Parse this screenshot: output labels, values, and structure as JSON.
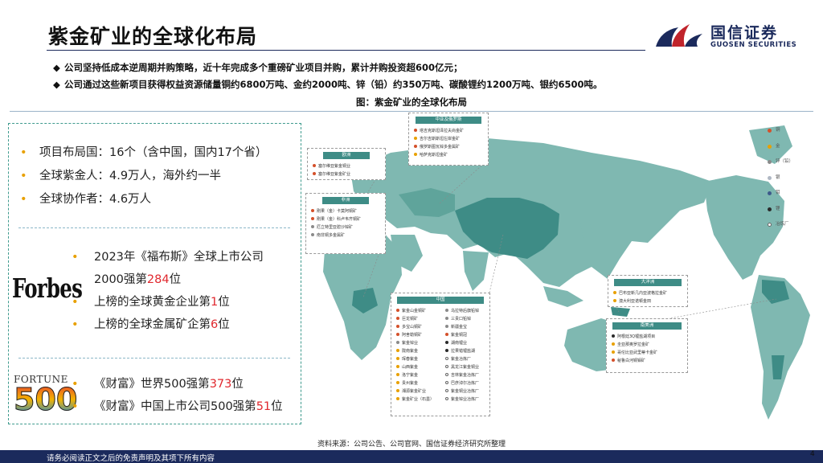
{
  "header": {
    "title": "紫金矿业的全球化布局",
    "logo_cn": "国信证券",
    "logo_en": "GUOSEN SECURITIES",
    "brand_colors": {
      "navy": "#1b2a5c",
      "red": "#c0242b",
      "teal": "#3f9b8e"
    }
  },
  "bullets": [
    "公司坚持低成本逆周期并购策略，近十年完成多个重磅矿业项目并购，累计并购投资超600亿元；",
    "公司通过这些新项目获得权益资源储量铜约6800万吨、金约2000吨、锌（铅）约350万吨、碳酸锂约1200万吨、银约6500吨。"
  ],
  "bullet_marker": "◆",
  "figure_title": "图：紫金矿业的全球化布局",
  "info_panel": {
    "stats": [
      "项目布局国：16个（含中国，国内17个省）",
      "全球紫金人：4.9万人，海外约一半",
      "全球协作者：4.6万人"
    ],
    "forbes": {
      "logo_text": "Forbes",
      "items": [
        {
          "pre": "2023年《福布斯》全球上市公司",
          "num": "",
          "post": ""
        },
        {
          "pre": "2000强第",
          "num": "284",
          "post": "位"
        },
        {
          "pre": "上榜的全球黄金企业第",
          "num": "1",
          "post": "位"
        },
        {
          "pre": "上榜的全球金属矿企第",
          "num": "6",
          "post": "位"
        }
      ]
    },
    "fortune": {
      "logo_word": "FORTUNE",
      "logo_number": "500",
      "items": [
        {
          "pre": "《财富》世界500强第",
          "num": "373",
          "post": "位"
        },
        {
          "pre": "《财富》中国上市公司500强第",
          "num": "51",
          "post": "位"
        }
      ]
    }
  },
  "map": {
    "land_color": "#7fb8b1",
    "ocean_color": "#ffffff",
    "highlight_color": "#3e8c86",
    "cards": {
      "central_asia": {
        "title": "中亚及俄罗斯",
        "items": [
          {
            "label": "塔吉克斯坦泽拉夫尚金矿",
            "color": "#d4502a"
          },
          {
            "label": "吉尔吉斯斯坦左岸金矿",
            "color": "#e8a000"
          },
          {
            "label": "俄罗斯图瓦锌多金属矿",
            "color": "#d4502a"
          },
          {
            "label": "哈萨克斯坦金矿",
            "color": "#e8a000"
          }
        ]
      },
      "europe": {
        "title": "欧洲",
        "items": [
          {
            "label": "塞尔维亚紫金铜业",
            "color": "#d4502a"
          },
          {
            "label": "塞尔维亚紫金矿业",
            "color": "#d4502a"
          }
        ]
      },
      "africa": {
        "title": "非洲",
        "items": [
          {
            "label": "刚果（金）卡莫阿铜矿",
            "color": "#d4502a"
          },
          {
            "label": "刚果（金）科卢韦齐铜矿",
            "color": "#d4502a"
          },
          {
            "label": "厄立特里亚碧沙锌矿",
            "color": "#8a8a8a"
          },
          {
            "label": "南非铜多金属矿",
            "color": "#8a8a8a"
          }
        ]
      },
      "china": {
        "title": "中国",
        "left": [
          {
            "label": "紫金山金铜矿",
            "color": "#d4502a"
          },
          {
            "label": "巨龙铜矿",
            "color": "#d4502a"
          },
          {
            "label": "多宝山铜矿",
            "color": "#d4502a"
          },
          {
            "label": "阿舍勒铜矿",
            "color": "#d4502a"
          },
          {
            "label": "紫金锌业",
            "color": "#8a8a8a"
          },
          {
            "label": "陇南紫金",
            "color": "#e8a000"
          },
          {
            "label": "珲春紫金",
            "color": "#e8a000"
          },
          {
            "label": "山西紫金",
            "color": "#e8a000"
          },
          {
            "label": "洛宁紫金",
            "color": "#e8a000"
          },
          {
            "label": "贵州紫金",
            "color": "#e8a000"
          },
          {
            "label": "湘源紫金矿业",
            "color": "#e8a000"
          },
          {
            "label": "紫金矿业（石墨）",
            "color": "#e8a000"
          }
        ],
        "right": [
          {
            "label": "乌拉特后旗铅锌",
            "color": "#8a8a8a"
          },
          {
            "label": "三贵口铅锌",
            "color": "#8a8a8a"
          },
          {
            "label": "新疆金宝",
            "color": "#8a8a8a"
          },
          {
            "label": "紫金铜冠",
            "color": "#d4502a"
          },
          {
            "label": "湖南锂业",
            "color": "#2a2a2a"
          },
          {
            "label": "拉果错锂盐湖",
            "color": "#2a2a2a"
          },
          {
            "label": "紫金冶炼厂",
            "color": "#ffffff"
          },
          {
            "label": "黑龙江紫金铜业",
            "color": "#ffffff"
          },
          {
            "label": "吉林紫金冶炼厂",
            "color": "#ffffff"
          },
          {
            "label": "巴彦淖尔冶炼厂",
            "color": "#ffffff"
          },
          {
            "label": "紫金铜业冶炼厂",
            "color": "#ffffff"
          },
          {
            "label": "紫金锌业冶炼厂",
            "color": "#ffffff"
          }
        ]
      },
      "oceania": {
        "title": "大洋洲",
        "items": [
          {
            "label": "巴布亚新几内亚波格拉金矿",
            "color": "#e8a000"
          },
          {
            "label": "澳大利亚诺顿金田",
            "color": "#e8a000"
          }
        ]
      },
      "south_america": {
        "title": "南美洲",
        "items": [
          {
            "label": "阿根廷3Q锂盐湖项目",
            "color": "#2a2a2a"
          },
          {
            "label": "圭亚那奥罗拉金矿",
            "color": "#e8a000"
          },
          {
            "label": "哥伦比亚武里蒂卡金矿",
            "color": "#e8a000"
          },
          {
            "label": "秘鲁白河铜钼矿",
            "color": "#d4502a"
          }
        ]
      }
    },
    "legend": [
      {
        "label": "铜",
        "color": "#d4502a"
      },
      {
        "label": "金",
        "color": "#e8a000"
      },
      {
        "label": "锌（铅）",
        "color": "#8a8a8a"
      },
      {
        "label": "银",
        "color": "#b0b8c4"
      },
      {
        "label": "钼",
        "color": "#3d5a8a"
      },
      {
        "label": "锂",
        "color": "#2a2a2a"
      },
      {
        "label": "冶炼厂",
        "color": "#ffffff"
      }
    ]
  },
  "source": "资料来源：公司公告、公司官网、国信证券经济研究所整理",
  "footer": "请务必阅读正文之后的免责声明及其项下所有内容",
  "page_number": "4"
}
